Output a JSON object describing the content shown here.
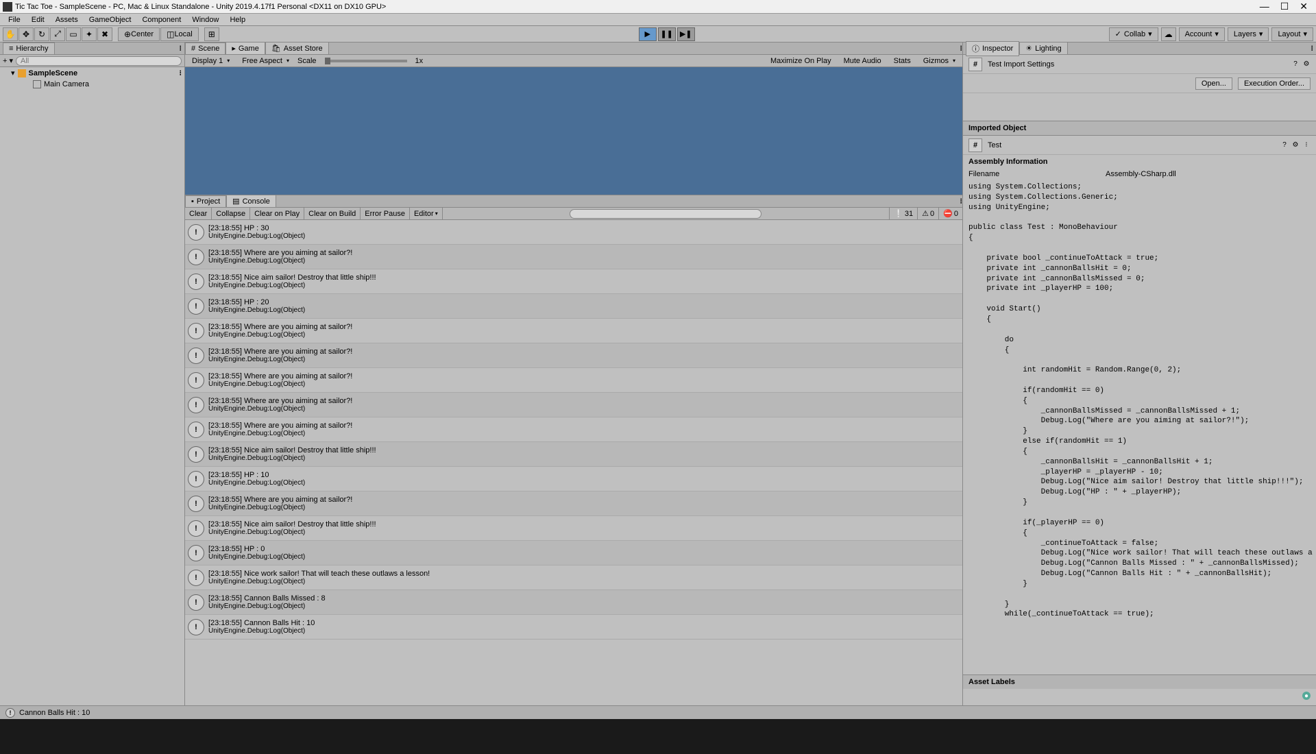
{
  "titlebar": {
    "text": "Tic Tac Toe - SampleScene - PC, Mac & Linux Standalone - Unity 2019.4.17f1 Personal <DX11 on DX10 GPU>"
  },
  "menubar": [
    "File",
    "Edit",
    "Assets",
    "GameObject",
    "Component",
    "Window",
    "Help"
  ],
  "toolbar": {
    "pivot": "Center",
    "space": "Local",
    "collab": "Collab",
    "account": "Account",
    "layers": "Layers",
    "layout": "Layout"
  },
  "hierarchy": {
    "tab": "Hierarchy",
    "searchPlaceholder": "All",
    "scene": "SampleScene",
    "items": [
      "Main Camera"
    ]
  },
  "gameTabs": {
    "scene": "Scene",
    "game": "Game",
    "assetStore": "Asset Store"
  },
  "gameToolbar": {
    "display": "Display 1",
    "aspect": "Free Aspect",
    "scale": "Scale",
    "scaleVal": "1x",
    "maximize": "Maximize On Play",
    "mute": "Mute Audio",
    "stats": "Stats",
    "gizmos": "Gizmos"
  },
  "consoleTabs": {
    "project": "Project",
    "console": "Console"
  },
  "consoleToolbar": {
    "clear": "Clear",
    "collapse": "Collapse",
    "clearPlay": "Clear on Play",
    "clearBuild": "Clear on Build",
    "errorPause": "Error Pause",
    "editor": "Editor",
    "info": "31",
    "warn": "0",
    "error": "0"
  },
  "consoleLogs": [
    {
      "msg": "[23:18:55] HP : 30",
      "src": "UnityEngine.Debug:Log(Object)"
    },
    {
      "msg": "[23:18:55] Where are you aiming at sailor?!",
      "src": "UnityEngine.Debug:Log(Object)"
    },
    {
      "msg": "[23:18:55] Nice aim sailor! Destroy that little ship!!!",
      "src": "UnityEngine.Debug:Log(Object)"
    },
    {
      "msg": "[23:18:55] HP : 20",
      "src": "UnityEngine.Debug:Log(Object)"
    },
    {
      "msg": "[23:18:55] Where are you aiming at sailor?!",
      "src": "UnityEngine.Debug:Log(Object)"
    },
    {
      "msg": "[23:18:55] Where are you aiming at sailor?!",
      "src": "UnityEngine.Debug:Log(Object)"
    },
    {
      "msg": "[23:18:55] Where are you aiming at sailor?!",
      "src": "UnityEngine.Debug:Log(Object)"
    },
    {
      "msg": "[23:18:55] Where are you aiming at sailor?!",
      "src": "UnityEngine.Debug:Log(Object)"
    },
    {
      "msg": "[23:18:55] Where are you aiming at sailor?!",
      "src": "UnityEngine.Debug:Log(Object)"
    },
    {
      "msg": "[23:18:55] Nice aim sailor! Destroy that little ship!!!",
      "src": "UnityEngine.Debug:Log(Object)"
    },
    {
      "msg": "[23:18:55] HP : 10",
      "src": "UnityEngine.Debug:Log(Object)"
    },
    {
      "msg": "[23:18:55] Where are you aiming at sailor?!",
      "src": "UnityEngine.Debug:Log(Object)"
    },
    {
      "msg": "[23:18:55] Nice aim sailor! Destroy that little ship!!!",
      "src": "UnityEngine.Debug:Log(Object)"
    },
    {
      "msg": "[23:18:55] HP : 0",
      "src": "UnityEngine.Debug:Log(Object)"
    },
    {
      "msg": "[23:18:55] Nice work sailor! That will teach these outlaws a lesson!",
      "src": "UnityEngine.Debug:Log(Object)"
    },
    {
      "msg": "[23:18:55] Cannon Balls Missed : 8",
      "src": "UnityEngine.Debug:Log(Object)"
    },
    {
      "msg": "[23:18:55] Cannon Balls Hit : 10",
      "src": "UnityEngine.Debug:Log(Object)"
    }
  ],
  "inspector": {
    "tab1": "Inspector",
    "tab2": "Lighting",
    "importTitle": "Test Import Settings",
    "open": "Open...",
    "execOrder": "Execution Order...",
    "importedObject": "Imported Object",
    "scriptName": "Test",
    "assemblyHeader": "Assembly Information",
    "filenameLabel": "Filename",
    "filenameValue": "Assembly-CSharp.dll",
    "assetLabels": "Asset Labels"
  },
  "code": "using System.Collections;\nusing System.Collections.Generic;\nusing UnityEngine;\n\npublic class Test : MonoBehaviour\n{\n\n    private bool _continueToAttack = true;\n    private int _cannonBallsHit = 0;\n    private int _cannonBallsMissed = 0;\n    private int _playerHP = 100;\n\n    void Start()\n    {\n\n        do\n        {\n\n            int randomHit = Random.Range(0, 2);\n\n            if(randomHit == 0)\n            {\n                _cannonBallsMissed = _cannonBallsMissed + 1;\n                Debug.Log(\"Where are you aiming at sailor?!\");\n            }\n            else if(randomHit == 1)\n            {\n                _cannonBallsHit = _cannonBallsHit + 1;\n                _playerHP = _playerHP - 10;\n                Debug.Log(\"Nice aim sailor! Destroy that little ship!!!\");\n                Debug.Log(\"HP : \" + _playerHP);\n            }\n\n            if(_playerHP == 0)\n            {\n                _continueToAttack = false;\n                Debug.Log(\"Nice work sailor! That will teach these outlaws a lesson!\");\n                Debug.Log(\"Cannon Balls Missed : \" + _cannonBallsMissed);\n                Debug.Log(\"Cannon Balls Hit : \" + _cannonBallsHit);\n            }\n\n        }\n        while(_continueToAttack == true);\n",
  "statusBar": {
    "text": "Cannon Balls Hit : 10"
  }
}
